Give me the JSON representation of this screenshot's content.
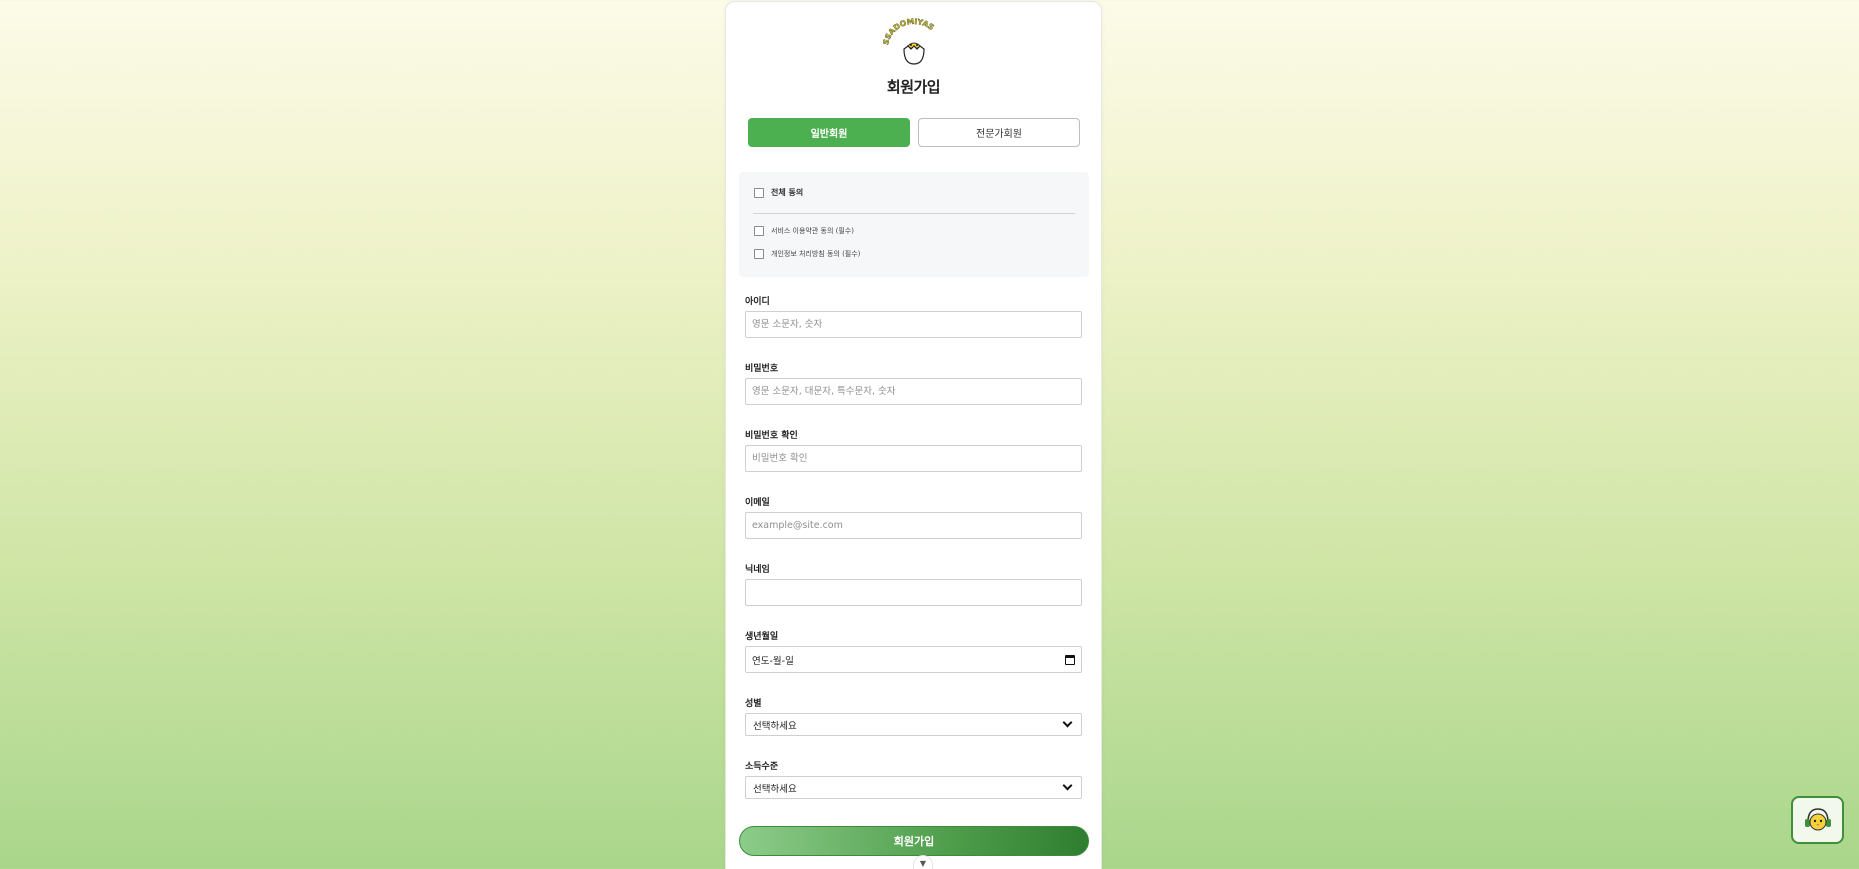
{
  "logo": {
    "text": "SSADOMIYAS",
    "icon": "hatching-chick-icon"
  },
  "page_title": "회원가입",
  "tabs": [
    {
      "label": "일반회원",
      "active": true
    },
    {
      "label": "전문가회원",
      "active": false
    }
  ],
  "agreements": {
    "all_label": "전체 동의",
    "items": [
      {
        "label": "서비스 이용약관 동의 (필수)"
      },
      {
        "label": "개인정보 처리방침 동의 (필수)"
      }
    ]
  },
  "fields": {
    "id": {
      "label": "아이디",
      "placeholder": "영문 소문자, 숫자",
      "value": ""
    },
    "password": {
      "label": "비밀번호",
      "placeholder": "영문 소문자, 대문자, 특수문자, 숫자",
      "value": ""
    },
    "password_confirm": {
      "label": "비밀번호 확인",
      "placeholder": "비밀번호 확인",
      "value": ""
    },
    "email": {
      "label": "이메일",
      "placeholder": "example@site.com",
      "value": ""
    },
    "nickname": {
      "label": "닉네임",
      "placeholder": "",
      "value": ""
    },
    "birthdate": {
      "label": "생년월일",
      "display": "연도-월-일"
    },
    "gender": {
      "label": "성별",
      "selected": "선택하세요"
    },
    "income": {
      "label": "소득수준",
      "selected": "선택하세요"
    }
  },
  "submit_label": "회원가입",
  "scroll_indicator": "▼",
  "chat_widget_icon": "chick-headset-icon",
  "colors": {
    "accent": "#4caf50",
    "accent_dark": "#2f7d2f",
    "background_top": "#fcfbe8",
    "background_bottom": "#a9d68b"
  }
}
